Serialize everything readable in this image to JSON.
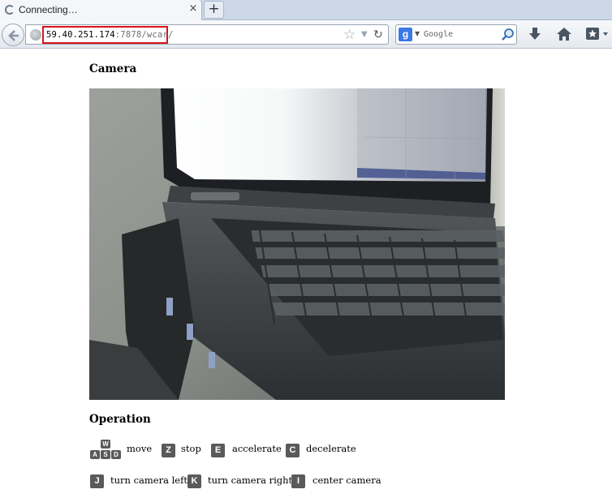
{
  "tab": {
    "title": "Connecting…",
    "close_symbol": "×",
    "new_tab_symbol": "+"
  },
  "address": {
    "host": "59.40.251.174",
    "rest": ":7878/wcar/"
  },
  "search": {
    "placeholder": "Google",
    "engine_letter": "g"
  },
  "page": {
    "camera_heading": "Camera",
    "operation_heading": "Operation"
  },
  "operations": {
    "move": {
      "keys": [
        "W",
        "A",
        "S",
        "D"
      ],
      "label": "move"
    },
    "stop": {
      "key": "Z",
      "label": "stop"
    },
    "accelerate": {
      "key": "E",
      "label": "accelerate"
    },
    "decelerate": {
      "key": "C",
      "label": "decelerate"
    },
    "turn_left": {
      "key": "J",
      "label": "turn camera left"
    },
    "turn_right": {
      "key": "K",
      "label": "turn camera right"
    },
    "center": {
      "key": "I",
      "label": "center camera"
    }
  },
  "colors": {
    "highlight": "#d8141e",
    "key_bg": "#5a5a5a"
  }
}
